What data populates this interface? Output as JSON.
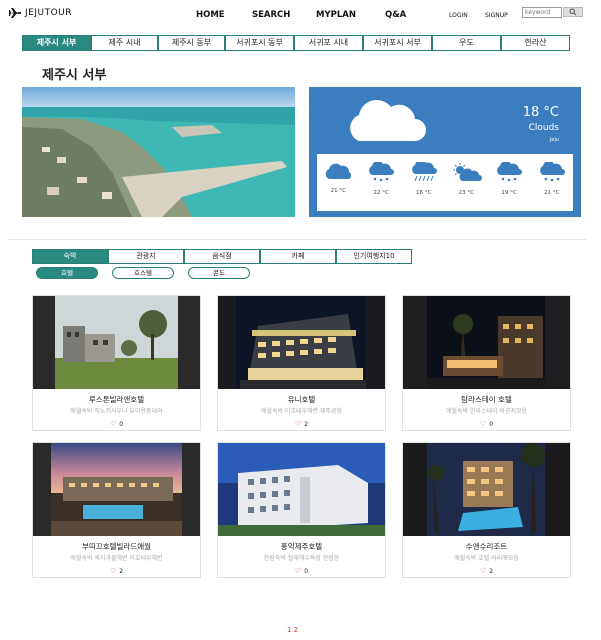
{
  "brand": {
    "name": "JEJUTOUR"
  },
  "nav": {
    "home": "HOME",
    "search": "SEARCH",
    "myplan": "MYPLAN",
    "qa": "Q&A",
    "login": "LOGIN",
    "signup": "SIGNUP",
    "search_placeholder": "keyword"
  },
  "regions": [
    {
      "label": "제주시 서부",
      "active": true
    },
    {
      "label": "제주 시내"
    },
    {
      "label": "제주시 동부"
    },
    {
      "label": "서귀포시 동부"
    },
    {
      "label": "서귀포 시내"
    },
    {
      "label": "서귀포시 서부"
    },
    {
      "label": "우도"
    },
    {
      "label": "한라산"
    }
  ],
  "page_title": "제주시 서부",
  "weather": {
    "temp": "18 °C",
    "desc": "Clouds",
    "location": "Jeju",
    "forecast": [
      {
        "icon": "cloud-icon",
        "temp": "21 °C"
      },
      {
        "icon": "snow-cloud-icon",
        "temp": "22 °C"
      },
      {
        "icon": "rain-cloud-icon",
        "temp": "16 °C"
      },
      {
        "icon": "sun-cloud-icon",
        "temp": "23 °C"
      },
      {
        "icon": "snow-cloud-icon",
        "temp": "19 °C"
      },
      {
        "icon": "snow-cloud-icon",
        "temp": "21 °C"
      }
    ]
  },
  "categories": [
    {
      "label": "숙박",
      "active": true
    },
    {
      "label": "관광지"
    },
    {
      "label": "음식점"
    },
    {
      "label": "카페"
    },
    {
      "label": "인기여행지10"
    }
  ],
  "subcats": [
    {
      "label": "호텔",
      "active": true
    },
    {
      "label": "호스텔"
    },
    {
      "label": "콘도"
    }
  ],
  "cards": [
    {
      "name": "루스톤빌라앤호텔",
      "desc": "애월숙박 히노키사우나 유아용품대여",
      "likes": "0"
    },
    {
      "name": "유니호텔",
      "desc": "애월숙박 이호테우해변 제주공항",
      "likes": "2"
    },
    {
      "name": "탐라스테이 호텔",
      "desc": "애월숙박 한라스테이 바공지모음",
      "likes": "0"
    },
    {
      "name": "부띠끄호텔빌라드애월",
      "desc": "애월숙박 곽지과물해변 이호테우해변",
      "likes": "2"
    },
    {
      "name": "홍익제주호텔",
      "desc": "한림숙박 협재해수욕장 한림항",
      "likes": "0"
    },
    {
      "name": "수앤수리조트",
      "desc": "애월숙박 호텔 바리애모음",
      "likes": "2"
    }
  ],
  "pagination": "1 2",
  "colors": {
    "accent": "#2a8a80",
    "weather_bg": "#3a7ebf"
  }
}
